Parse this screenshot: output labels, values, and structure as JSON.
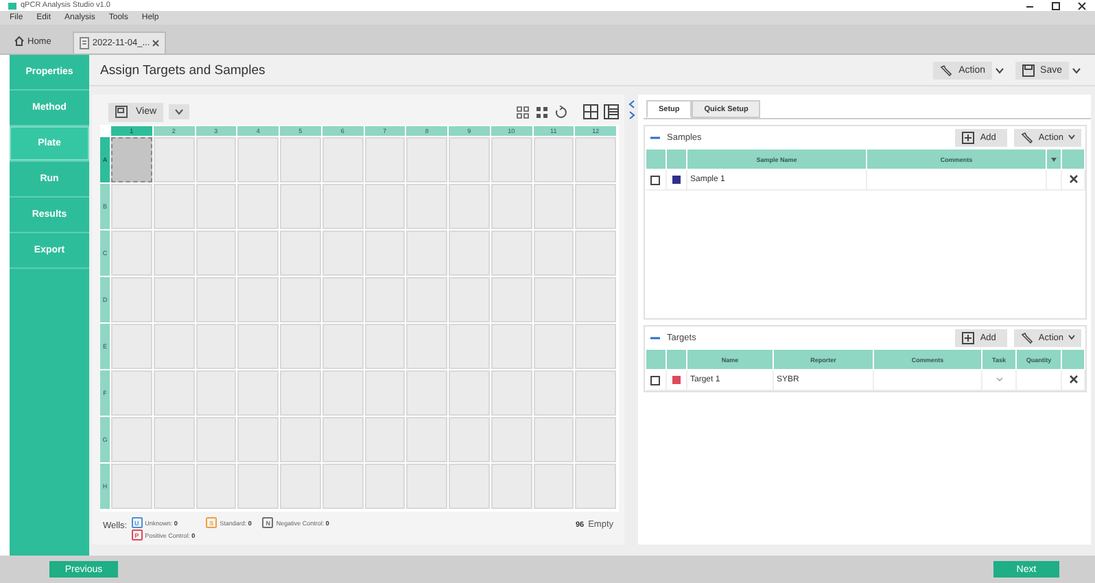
{
  "window": {
    "title": "qPCR Analysis Studio v1.0"
  },
  "menu": [
    "File",
    "Edit",
    "Analysis",
    "Tools",
    "Help"
  ],
  "tabs": [
    {
      "label": "Home",
      "kind": "home",
      "selected": false
    },
    {
      "label": "2022-11-04_...",
      "kind": "document",
      "selected": true
    }
  ],
  "sidebar": {
    "items": [
      {
        "label": "Properties",
        "selected": false
      },
      {
        "label": "Method",
        "selected": false
      },
      {
        "label": "Plate",
        "selected": true
      },
      {
        "label": "Run",
        "selected": false
      },
      {
        "label": "Results",
        "selected": false
      },
      {
        "label": "Export",
        "selected": false
      }
    ]
  },
  "header": {
    "title": "Assign Targets and Samples",
    "buttons": [
      {
        "label": "Action",
        "kind": "action"
      },
      {
        "label": "Save",
        "kind": "save"
      }
    ]
  },
  "plate": {
    "view_button": "View",
    "columns": [
      {
        "label": "1",
        "selected": true
      },
      {
        "label": "2",
        "selected": false
      },
      {
        "label": "3",
        "selected": false
      },
      {
        "label": "4",
        "selected": false
      },
      {
        "label": "5",
        "selected": false
      },
      {
        "label": "6",
        "selected": false
      },
      {
        "label": "7",
        "selected": false
      },
      {
        "label": "8",
        "selected": false
      },
      {
        "label": "9",
        "selected": false
      },
      {
        "label": "10",
        "selected": false
      },
      {
        "label": "11",
        "selected": false
      },
      {
        "label": "12",
        "selected": false
      }
    ],
    "rows": [
      {
        "label": "A",
        "selected": true
      },
      {
        "label": "B",
        "selected": false
      },
      {
        "label": "C",
        "selected": false
      },
      {
        "label": "D",
        "selected": false
      },
      {
        "label": "E",
        "selected": false
      },
      {
        "label": "F",
        "selected": false
      },
      {
        "label": "G",
        "selected": false
      },
      {
        "label": "H",
        "selected": false
      }
    ],
    "legend": {
      "label": "Wells:",
      "items": [
        {
          "letter": "U",
          "label": "Unknown:",
          "count": "0",
          "color": "#4a90d9"
        },
        {
          "letter": "S",
          "label": "Standard:",
          "count": "0",
          "color": "#f0a040"
        },
        {
          "letter": "N",
          "label": "Negative Control:",
          "count": "0",
          "color": "#707070"
        },
        {
          "letter": "P",
          "label": "Positive Control:",
          "count": "0",
          "color": "#e04a5a"
        }
      ]
    },
    "summary": {
      "count": "96",
      "label": "Empty"
    }
  },
  "panel": {
    "tabs": [
      {
        "label": "Setup",
        "selected": true
      },
      {
        "label": "Quick Setup",
        "selected": false
      }
    ],
    "samples": {
      "title": "Samples",
      "expanded": true,
      "add": "Add",
      "action": "Action",
      "columns": [
        "Sample Name",
        "Comments"
      ],
      "rows": [
        {
          "checked": false,
          "color": "#2f2f8f",
          "name": "Sample 1"
        }
      ]
    },
    "targets": {
      "title": "Targets",
      "expanded": true,
      "add": "Add",
      "action": "Action",
      "columns": [
        "Name",
        "Reporter",
        "Comments",
        "Task",
        "Quantity"
      ],
      "rows": [
        {
          "checked": false,
          "color": "#e04a5a",
          "name": "Target 1",
          "reporter": "SYBR"
        }
      ]
    }
  },
  "footer": {
    "previous": "Previous",
    "next": "Next"
  }
}
